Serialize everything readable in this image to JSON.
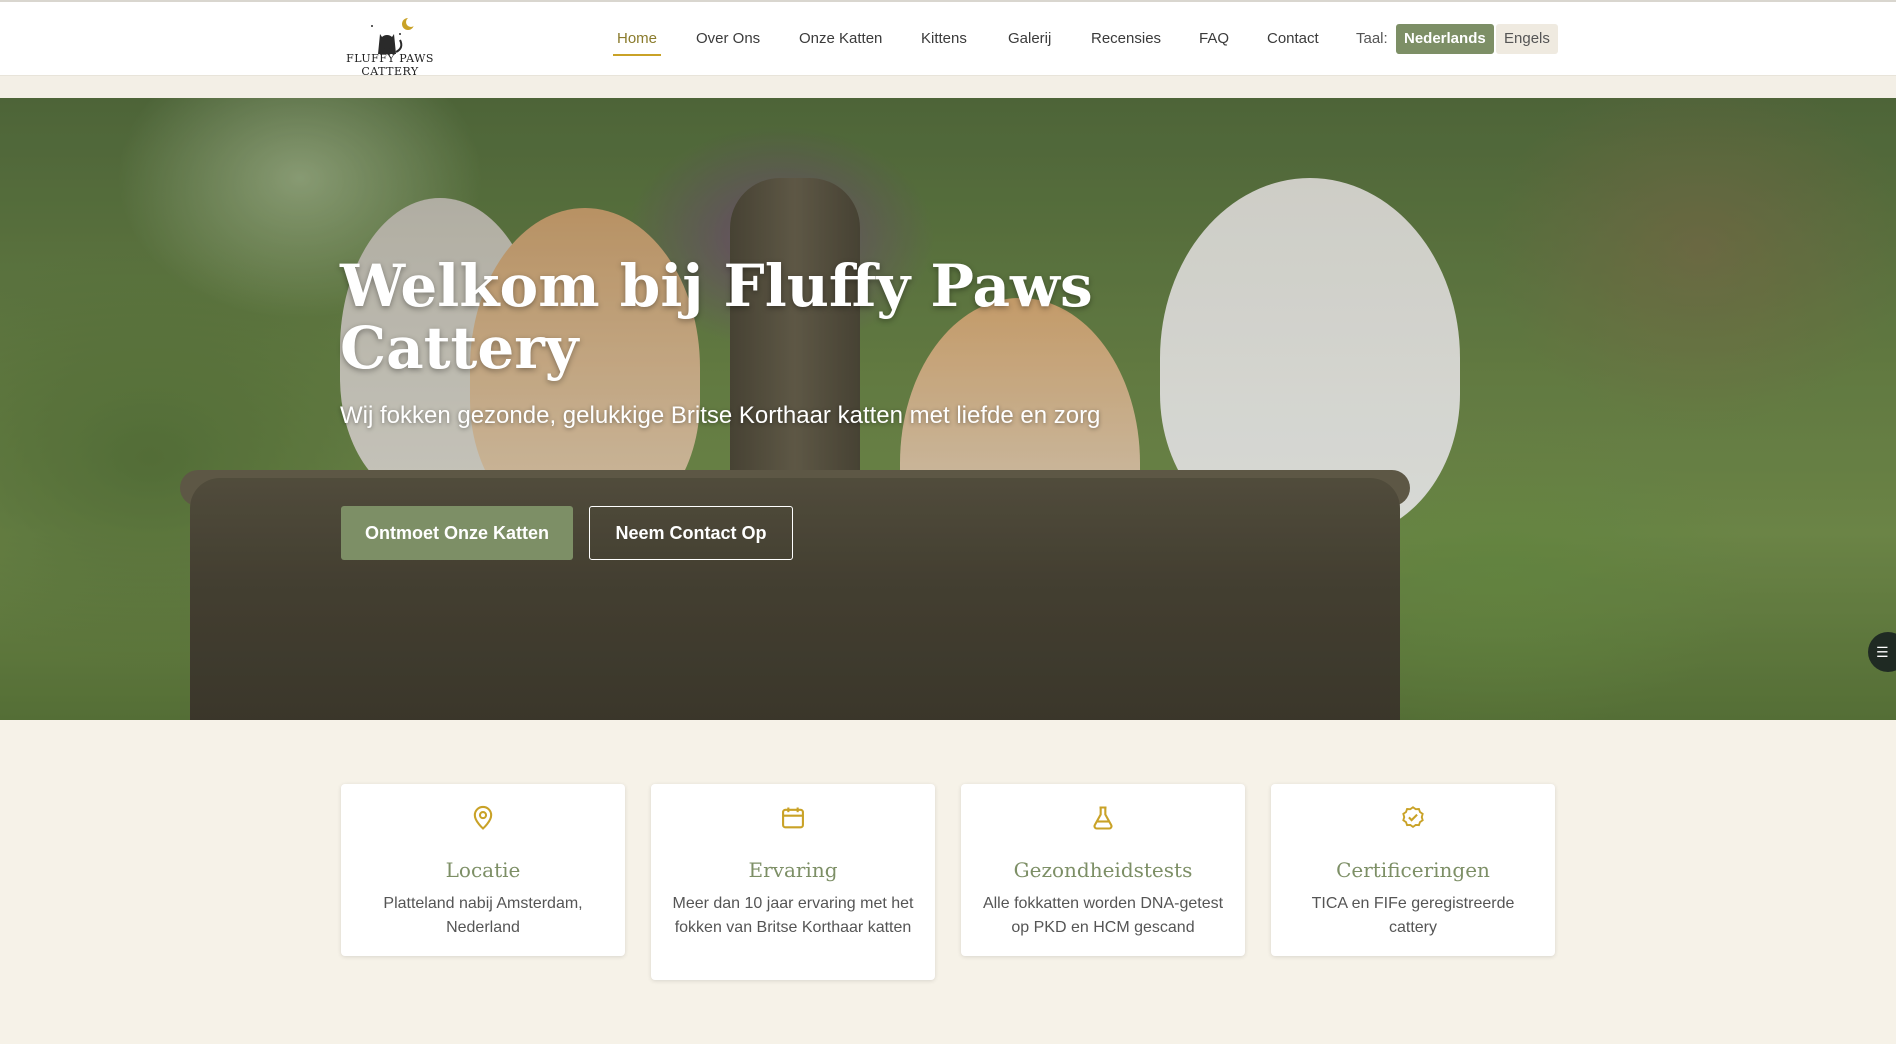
{
  "brand": {
    "logo_text": "FLUFFY PAWS CATTERY"
  },
  "nav": {
    "items": [
      {
        "label": "Home",
        "active": true
      },
      {
        "label": "Over Ons"
      },
      {
        "label": "Onze Katten"
      },
      {
        "label": "Kittens"
      },
      {
        "label": "Galerij"
      },
      {
        "label": "Recensies"
      },
      {
        "label": "FAQ"
      },
      {
        "label": "Contact"
      }
    ],
    "language_label": "Taal:",
    "languages": [
      {
        "label": "Nederlands",
        "selected": true
      },
      {
        "label": "Engels"
      }
    ]
  },
  "hero": {
    "title": "Welkom bij Fluffy Paws Cattery",
    "subtitle": "Wij fokken gezonde, gelukkige Britse Korthaar katten met liefde en zorg",
    "primary_button": "Ontmoet Onze Katten",
    "secondary_button": "Neem Contact Op"
  },
  "features": [
    {
      "icon": "location-pin-icon",
      "title": "Locatie",
      "text": "Platteland nabij Amsterdam, Nederland"
    },
    {
      "icon": "calendar-icon",
      "title": "Ervaring",
      "text": "Meer dan 10 jaar ervaring met het fokken van Britse Korthaar katten"
    },
    {
      "icon": "flask-icon",
      "title": "Gezondheidstests",
      "text": "Alle fokkatten worden DNA-getest op PKD en HCM gescand"
    },
    {
      "icon": "badge-check-icon",
      "title": "Certificeringen",
      "text": "TICA en FIFe geregistreerde cattery"
    }
  ],
  "colors": {
    "accent_green": "#7d8f66",
    "accent_gold": "#c9a227",
    "background_cream": "#f6f2e8"
  }
}
